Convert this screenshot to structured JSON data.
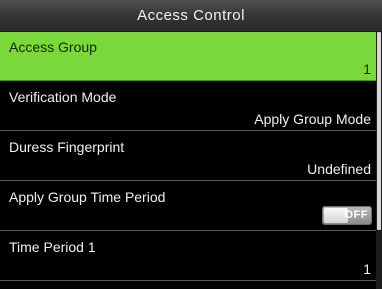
{
  "header": {
    "title": "Access Control"
  },
  "menu": {
    "items": [
      {
        "label": "Access Group",
        "value": "1",
        "selected": true
      },
      {
        "label": "Verification Mode",
        "value": "Apply Group Mode",
        "selected": false
      },
      {
        "label": "Duress Fingerprint",
        "value": "Undefined",
        "selected": false
      },
      {
        "label": "Apply Group Time Period",
        "toggle": "OFF",
        "toggle_on": false,
        "selected": false
      },
      {
        "label": "Time Period 1",
        "value": "1",
        "selected": false
      }
    ]
  },
  "colors": {
    "selected_background": "#7ad83a",
    "background": "#000000",
    "text": "#f0f0f0"
  }
}
